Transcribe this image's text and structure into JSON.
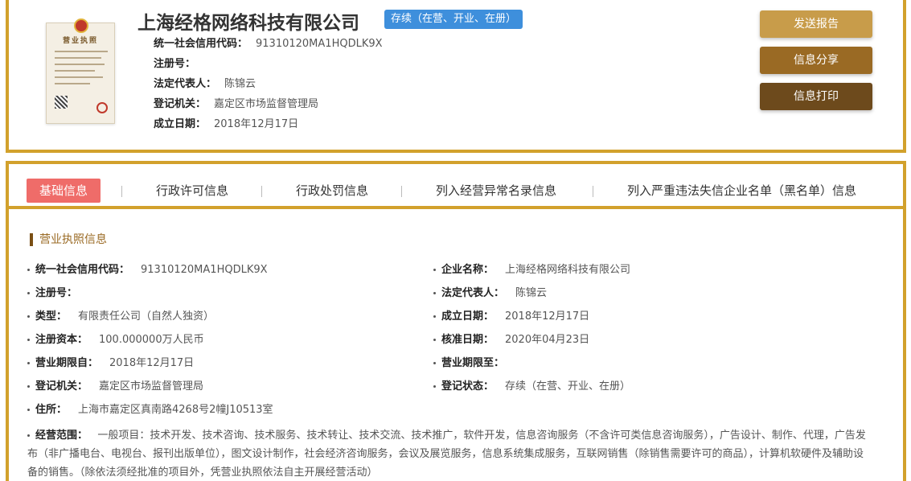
{
  "header": {
    "company_name": "上海经格网络科技有限公司",
    "status_tag": "存续（在营、开业、在册）",
    "license_thumb_title": "营业执照",
    "rows": [
      {
        "label": "统一社会信用代码：",
        "value": "91310120MA1HQDLK9X"
      },
      {
        "label": "注册号：",
        "value": ""
      },
      {
        "label": "法定代表人：",
        "value": "陈锦云"
      },
      {
        "label": "登记机关：",
        "value": "嘉定区市场监督管理局"
      },
      {
        "label": "成立日期：",
        "value": "2018年12月17日"
      }
    ]
  },
  "actions": {
    "send_report": "发送报告",
    "share_info": "信息分享",
    "print_info": "信息打印"
  },
  "tabs": [
    {
      "label": "基础信息",
      "active": true
    },
    {
      "label": "行政许可信息",
      "active": false
    },
    {
      "label": "行政处罚信息",
      "active": false
    },
    {
      "label": "列入经营异常名录信息",
      "active": false
    },
    {
      "label": "列入严重违法失信企业名单（黑名单）信息",
      "active": false
    }
  ],
  "section": {
    "title": "营业执照信息",
    "left_fields": [
      {
        "label": "统一社会信用代码：",
        "value": "91310120MA1HQDLK9X"
      },
      {
        "label": "注册号：",
        "value": ""
      },
      {
        "label": "类型：",
        "value": "有限责任公司（自然人独资）"
      },
      {
        "label": "注册资本：",
        "value": "100.000000万人民币"
      },
      {
        "label": "营业期限自：",
        "value": "2018年12月17日"
      },
      {
        "label": "登记机关：",
        "value": "嘉定区市场监督管理局"
      },
      {
        "label": "住所：",
        "value": "上海市嘉定区真南路4268号2幢J10513室"
      }
    ],
    "right_fields": [
      {
        "label": "企业名称：",
        "value": "上海经格网络科技有限公司"
      },
      {
        "label": "法定代表人：",
        "value": "陈锦云"
      },
      {
        "label": "成立日期：",
        "value": "2018年12月17日"
      },
      {
        "label": "核准日期：",
        "value": "2020年04月23日"
      },
      {
        "label": "营业期限至：",
        "value": ""
      },
      {
        "label": "登记状态：",
        "value": "存续（在营、开业、在册）"
      }
    ],
    "scope": {
      "label": "经营范围：",
      "value": "一般项目：技术开发、技术咨询、技术服务、技术转让、技术交流、技术推广，软件开发，信息咨询服务（不含许可类信息咨询服务），广告设计、制作、代理，广告发布（非广播电台、电视台、报刊出版单位），图文设计制作，社会经济咨询服务，会议及展览服务，信息系统集成服务，互联网销售（除销售需要许可的商品），计算机软硬件及辅助设备的销售。（除依法须经批准的项目外，凭营业执照依法自主开展经营活动）"
    }
  },
  "colors": {
    "border_gold": "#d2a12c",
    "active_tab": "#ef6c69",
    "status_blue": "#3e8fdc",
    "btn_send": "#c89c4a",
    "btn_share": "#9a6a24",
    "btn_print": "#6d4a1c"
  }
}
